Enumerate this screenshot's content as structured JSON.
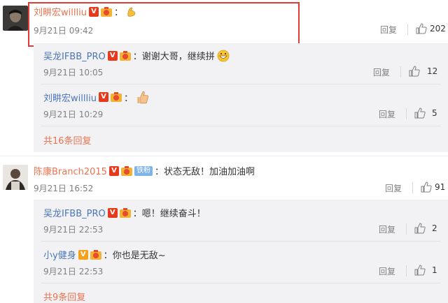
{
  "comments": [
    {
      "user": "刘畊宏willliu",
      "badge_v": "V",
      "text": "：",
      "emoji": "flexed-biceps-icon",
      "time": "9月21日 09:42",
      "reply": "回复",
      "likes": "202",
      "replies": [
        {
          "user": "吴龙IFBB_PRO",
          "badge_v": "V",
          "text": "：谢谢大哥，继续拼",
          "emoji": "grinning-face-icon",
          "time": "9月21日 10:05",
          "reply": "回复",
          "likes": "12"
        },
        {
          "user": "刘畊宏willliu",
          "badge_v": "V",
          "text": "：",
          "emoji": "thumbs-up-icon",
          "time": "9月21日 10:29",
          "reply": "回复",
          "likes": "5"
        }
      ],
      "more": "共16条回复"
    },
    {
      "user": "陈康Branch2015",
      "badge_v": "V",
      "fan_badge": "铁粉",
      "text": "：状态无敌！加油加油啊",
      "time": "9月21日 16:52",
      "reply": "回复",
      "likes": "91",
      "replies": [
        {
          "user": "吴龙IFBB_PRO",
          "badge_v": "V",
          "text": "：嗯！继续奋斗！",
          "time": "9月21日 22:53",
          "reply": "回复",
          "likes": "2"
        },
        {
          "user": "小y健身",
          "badge_v": "V",
          "text": "：你也是无敌~",
          "time": "9月21日 22:53",
          "reply": "回复",
          "likes": "1"
        }
      ],
      "more": "共9条回复"
    }
  ],
  "colors": {
    "username": "#eb7350",
    "reply_bg": "#f2f2f5",
    "highlight": "#e53935",
    "verified_red": "#e8391d",
    "verified_gold": "#f6a11c"
  }
}
